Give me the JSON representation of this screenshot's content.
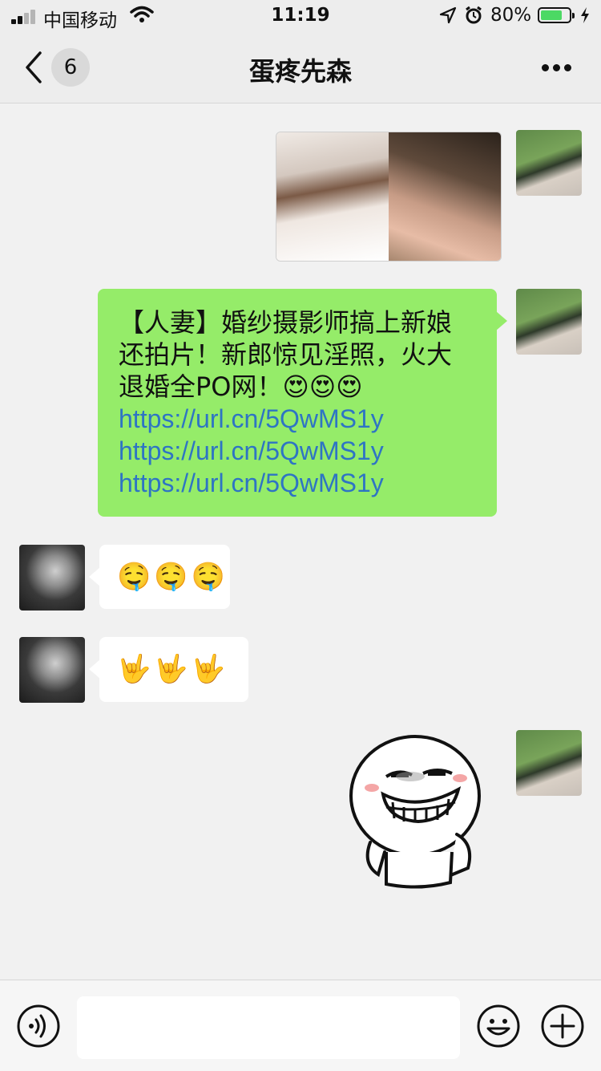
{
  "status_bar": {
    "carrier": "中国移动",
    "time": "11:19",
    "battery_percent": "80%",
    "battery_level": 0.8,
    "signal_bars": 2
  },
  "nav": {
    "back_icon": "chevron-left-icon",
    "unread_count": "6",
    "title": "蛋疼先森",
    "more_icon": "more-dots-icon"
  },
  "messages": [
    {
      "sender": "self",
      "type": "image"
    },
    {
      "sender": "self",
      "type": "text",
      "lines": [
        "【人妻】婚纱摄影师搞上新娘",
        "还拍片！新郎惊见淫照，火大",
        "退婚全PO网！😍😍😍"
      ],
      "links": [
        "https://url.cn/5QwMS1y",
        "https://url.cn/5QwMS1y",
        "https://url.cn/5QwMS1y"
      ]
    },
    {
      "sender": "other",
      "type": "emoji",
      "text": "🤤🤤🤤"
    },
    {
      "sender": "other",
      "type": "emoji",
      "text": "🤟🤟🤟"
    },
    {
      "sender": "self",
      "type": "sticker"
    }
  ],
  "toolbar": {
    "voice_icon": "voice-icon",
    "emoji_icon": "emoji-icon",
    "plus_icon": "plus-icon"
  },
  "colors": {
    "self_bubble": "#95ec69",
    "other_bubble": "#ffffff",
    "link": "#2e74c4",
    "background": "#f1f1f1"
  }
}
